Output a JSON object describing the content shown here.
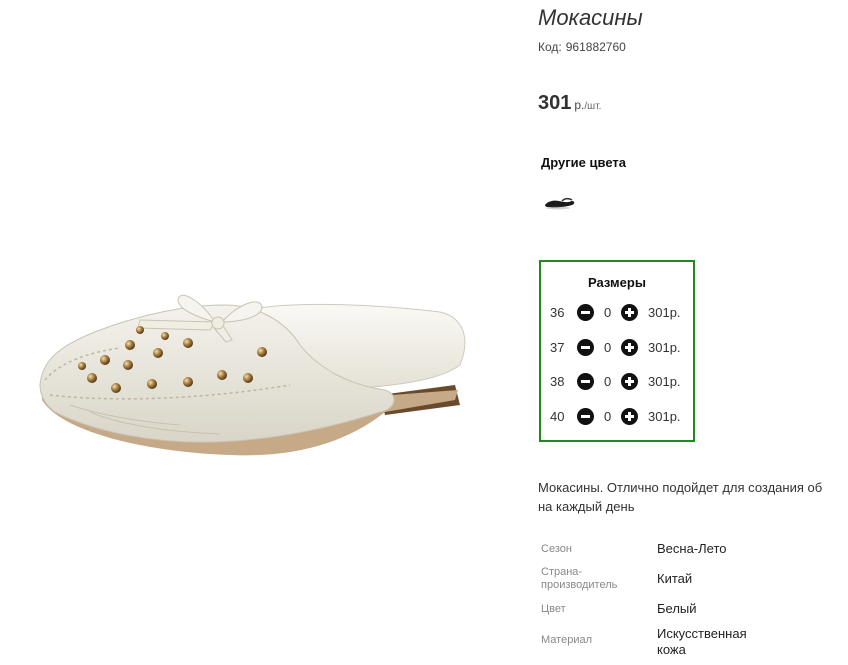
{
  "product": {
    "title": "Мокасины",
    "code_label": "Код:",
    "code_value": "961882760",
    "price_value": "301",
    "price_currency": "р.",
    "price_per": "/шт.",
    "image_icon": "white-studded-mule-loafer-image"
  },
  "other_colors": {
    "title": "Другие цвета",
    "swatches": [
      {
        "icon": "black-shoe-thumbnail"
      }
    ]
  },
  "sizes": {
    "title": "Размеры",
    "rows": [
      {
        "size": "36",
        "qty": "0",
        "price": "301р."
      },
      {
        "size": "37",
        "qty": "0",
        "price": "301р."
      },
      {
        "size": "38",
        "qty": "0",
        "price": "301р."
      },
      {
        "size": "40",
        "qty": "0",
        "price": "301р."
      }
    ],
    "border_color": "#1e8b1e"
  },
  "description": {
    "line1": "Мокасины. Отлично подойдет для создания об",
    "line2": "на каждый день"
  },
  "specs": [
    {
      "label": "Сезон",
      "value": "Весна-Лето"
    },
    {
      "label": "Страна-производитель",
      "label_line1": "Страна-",
      "label_line2": "производитель",
      "value": "Китай"
    },
    {
      "label": "Цвет",
      "value": "Белый"
    },
    {
      "label": "Материал",
      "value_line1": "Искусственная",
      "value_line2": "кожа"
    }
  ]
}
